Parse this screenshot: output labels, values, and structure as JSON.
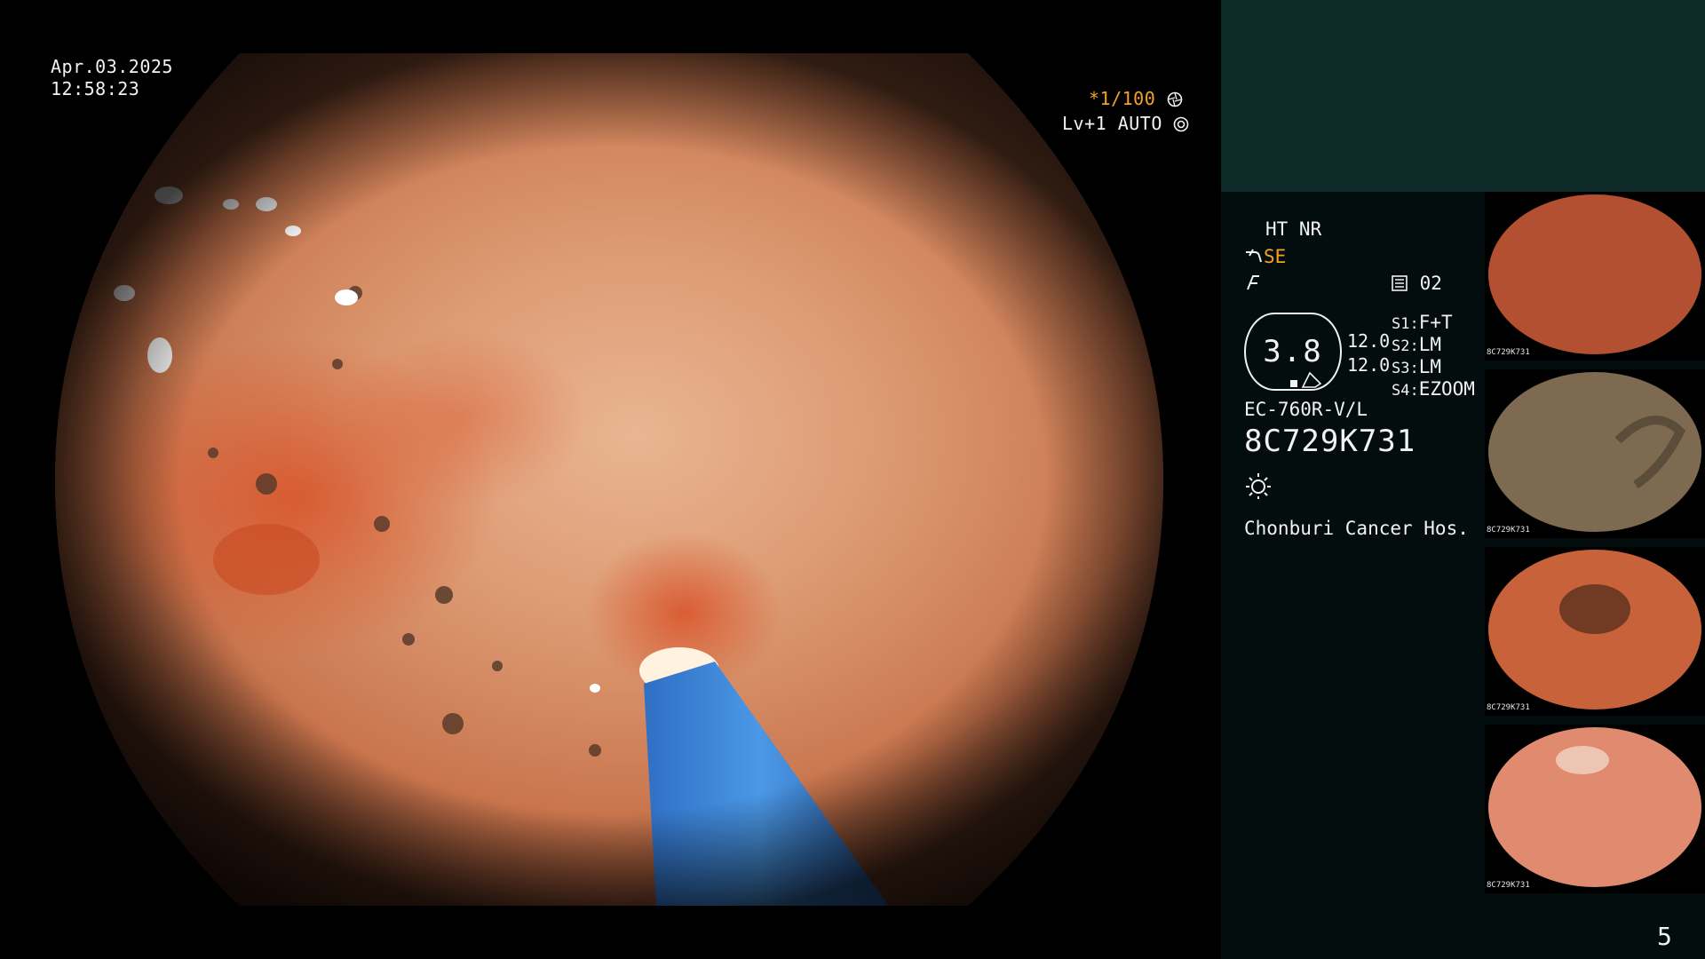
{
  "timestamp": {
    "date": "Apr.03.2025",
    "time": "12:58:23"
  },
  "overlay": {
    "shutter": "*1/100",
    "shutter_prefix": "*",
    "shutter_value": "1/100",
    "level": "Lv+1 AUTO"
  },
  "panel": {
    "ht_nr": "HT NR",
    "se_label": "SE",
    "frame_label": "02",
    "zoom_value": "3.8",
    "values": [
      "12.0",
      "12.0"
    ],
    "settings": [
      {
        "key": "S1:",
        "value": "F+T"
      },
      {
        "key": "S2:",
        "value": "LM"
      },
      {
        "key": "S3:",
        "value": "LM"
      },
      {
        "key": "S4:",
        "value": "EZOOM"
      }
    ],
    "scope_model": "EC-760R-V/L",
    "serial": "8C729K731",
    "hospital": "Chonburi Cancer Hos.",
    "page_number": "5"
  },
  "thumbnails": [
    {
      "label": "8C729K731",
      "tone": "#d35f3a"
    },
    {
      "label": "8C729K731",
      "tone": "#7d6a50"
    },
    {
      "label": "8C729K731",
      "tone": "#c8623a"
    },
    {
      "label": "8C729K731",
      "tone": "#e08a70"
    }
  ],
  "colors": {
    "accent": "#f3a229",
    "panel_header": "#0d2a29",
    "panel_bg": "#040d0d"
  },
  "icons": [
    "aperture-icon",
    "auto-iris-icon",
    "hose-icon",
    "enhance-icon",
    "memory-icon",
    "light-icon"
  ]
}
